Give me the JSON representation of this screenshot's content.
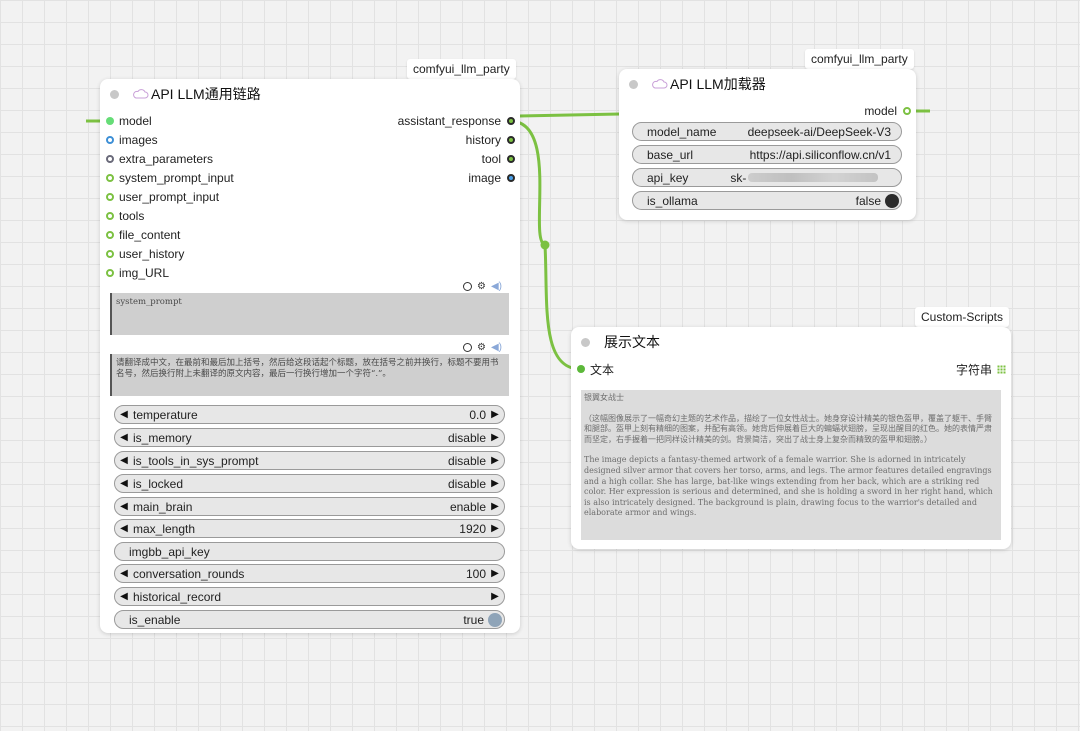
{
  "colors": {
    "wire_green": "#7cc142",
    "canvas_bg": "#f2f2f2",
    "node_bg": "#ffffff",
    "widget_bg": "#e7e7e7",
    "textarea_bg": "#cfcfcf"
  },
  "llm_chain_node": {
    "badge": "comfyui_llm_party",
    "title": "API LLM通用链路",
    "title_icon": "cloud-icon",
    "inputs": [
      "model",
      "images",
      "extra_parameters",
      "system_prompt_input",
      "user_prompt_input",
      "tools",
      "file_content",
      "user_history",
      "img_URL"
    ],
    "outputs": [
      "assistant_response",
      "history",
      "tool",
      "image"
    ],
    "system_prompt_placeholder": "system_prompt",
    "user_prompt_text": "请翻译成中文，在最前和最后加上括号，然后给这段话起个标题，放在括号之前并换行，标题不要用书名号，然后换行附上未翻译的原文内容，最后一行换行增加一个字符“.”。",
    "widgets": [
      {
        "label": "temperature",
        "value": "0.0"
      },
      {
        "label": "is_memory",
        "value": "disable"
      },
      {
        "label": "is_tools_in_sys_prompt",
        "value": "disable"
      },
      {
        "label": "is_locked",
        "value": "disable"
      },
      {
        "label": "main_brain",
        "value": "enable"
      },
      {
        "label": "max_length",
        "value": "1920"
      },
      {
        "label": "imgbb_api_key",
        "value": ""
      },
      {
        "label": "conversation_rounds",
        "value": "100"
      },
      {
        "label": "historical_record",
        "value": ""
      },
      {
        "label": "is_enable",
        "value": "true"
      }
    ]
  },
  "llm_loader_node": {
    "badge": "comfyui_llm_party",
    "title": "API LLM加载器",
    "title_icon": "cloud-icon",
    "output": "model",
    "fields": [
      {
        "label": "model_name",
        "value": "deepseek-ai/DeepSeek-V3"
      },
      {
        "label": "base_url",
        "value": "https://api.siliconflow.cn/v1"
      },
      {
        "label": "api_key",
        "value": "sk-"
      },
      {
        "label": "is_ollama",
        "value": "false"
      }
    ]
  },
  "show_text_node": {
    "badge": "Custom-Scripts",
    "title": "展示文本",
    "input": "文本",
    "output": "字符串",
    "output_icon": "grid-icon",
    "preview_title": "银翼女战士",
    "preview_chinese": "（这幅图像展示了一幅奇幻主题的艺术作品，描绘了一位女性战士。她身穿设计精美的银色盔甲，覆盖了躯干、手臂和腿部。盔甲上刻有精细的图案，并配有高领。她背后伸展着巨大的蝙蝠状翅膀，呈现出醒目的红色。她的表情严肃而坚定，右手握着一把同样设计精美的剑。背景简洁，突出了战士身上复杂而精致的盔甲和翅膀。）",
    "preview_english": "The image depicts a fantasy-themed artwork of a female warrior. She is adorned in intricately designed silver armor that covers her torso, arms, and legs. The armor features detailed engravings and a high collar. She has large, bat-like wings extending from her back, which are a striking red color. Her expression is serious and determined, and she is holding a sword in her right hand, which is also intricately designed. The background is plain, drawing focus to the warrior's detailed and elaborate armor and wings."
  }
}
